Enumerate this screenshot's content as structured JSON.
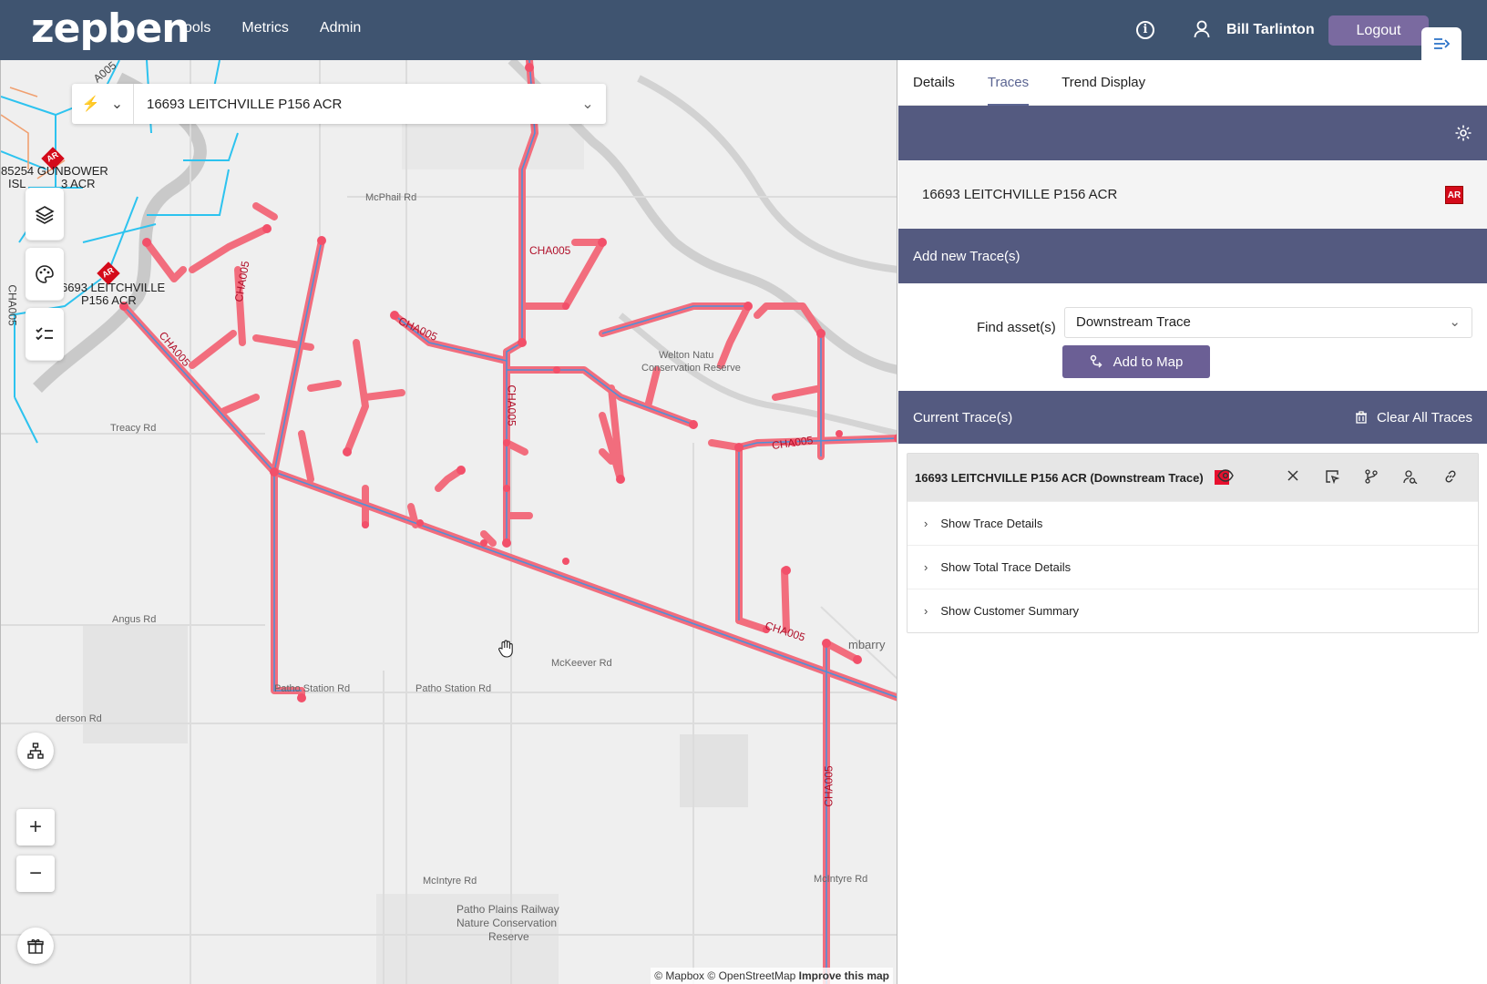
{
  "header": {
    "logo": "zepben",
    "nav": [
      "Tools",
      "Metrics",
      "Admin"
    ],
    "user": "Bill Tarlinton",
    "logout": "Logout"
  },
  "map": {
    "search_value": "16693 LEITCHVILLE P156 ACR",
    "attribution": {
      "mapbox": "© Mapbox",
      "osm": "© OpenStreetMap",
      "improve": "Improve this map"
    },
    "zoom_in": "+",
    "zoom_out": "−",
    "labels": {
      "gunbower": "85254 GUNBOWER",
      "isl": "ISL",
      "isl2": "3 ACR",
      "leitch1": "6693 LEITCHVILLE",
      "leitch2": "P156 ACR",
      "mcphail": "McPhail Rd",
      "treacy": "Treacy Rd",
      "angus": "Angus Rd",
      "derson": "derson Rd",
      "mckeever": "McKeever Rd",
      "patho_station1": "Patho Station Rd",
      "patho_station2": "Patho Station Rd",
      "welton1": "Welton Natu",
      "welton2": "Conservation Reserve",
      "mcintyre1": "McIntyre Rd",
      "mcintyre2": "McIntyre Rd",
      "patho_plains1": "Patho Plains Railway",
      "patho_plains2": "Nature Conservation",
      "patho_plains3": "Reserve",
      "kumbarry": "mbarry",
      "cha1": "CHA005",
      "cha2": "CHA005",
      "cha3": "CHA005",
      "cha4": "CHA005",
      "cha5": "CHA005",
      "cha6": "CHA005",
      "cha7": "CHA005",
      "cha8": "CHA005",
      "cha9": "CHA005",
      "a005": "A005"
    },
    "badges": {
      "ar1": "AR",
      "ar2": "AR"
    }
  },
  "panel": {
    "tabs": [
      "Details",
      "Traces",
      "Trend Display"
    ],
    "active_tab": "Traces",
    "asset_name": "16693 LEITCHVILLE P156 ACR",
    "asset_badge": "AR",
    "add_section_title": "Add new Trace(s)",
    "find_label": "Find asset(s)",
    "find_value": "Downstream Trace",
    "add_button": "Add to Map",
    "current_title": "Current Trace(s)",
    "clear_button": "Clear All Traces",
    "trace": {
      "title": "16693 LEITCHVILLE P156 ACR (Downstream Trace)",
      "color": "#e8102e",
      "rows": [
        "Show Trace Details",
        "Show Total Trace Details",
        "Show Customer Summary"
      ]
    }
  },
  "colors": {
    "header": "#3f5470",
    "section_bar": "#545a80",
    "button": "#6b5f95",
    "trace": "#f26d7d"
  }
}
